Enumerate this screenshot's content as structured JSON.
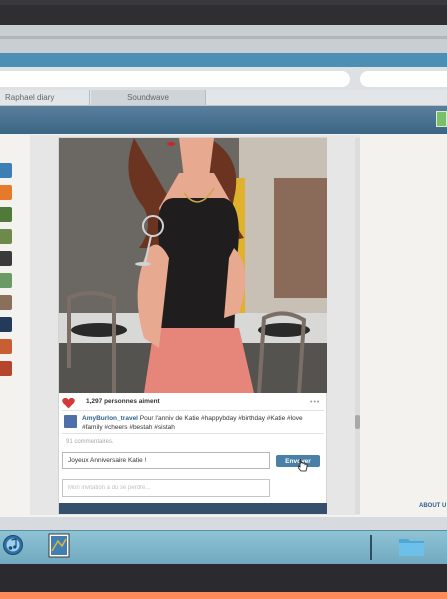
{
  "bookmarks": [
    "Raphael diary",
    "Soundwave"
  ],
  "post": {
    "likes_text": "1,297 personnes aiment",
    "more_label": "•••",
    "caption_user": "AmyBurlon_travel",
    "caption_text": " Pour l'anniv de Katie #happybday #birthday #Katie #love #family #cheers #bestah #sistah",
    "comments_count": "91 commentaires.",
    "comment_value": "Joyeux Anniversaire Katie !",
    "send_label": "Envoyer",
    "invite_placeholder": "Mon invitation a du se perdre..."
  },
  "about_link": "ABOUT U",
  "dock_icons": [
    "itunes-icon",
    "preview-icon",
    "folder-icon"
  ],
  "colors": {
    "accent_blue": "#4a7fa8",
    "heart_red": "#d23a3a",
    "header_blue": "#3b6584",
    "dock_blue": "#8fc3d4",
    "bottom_orange": "#ff8b5a"
  }
}
